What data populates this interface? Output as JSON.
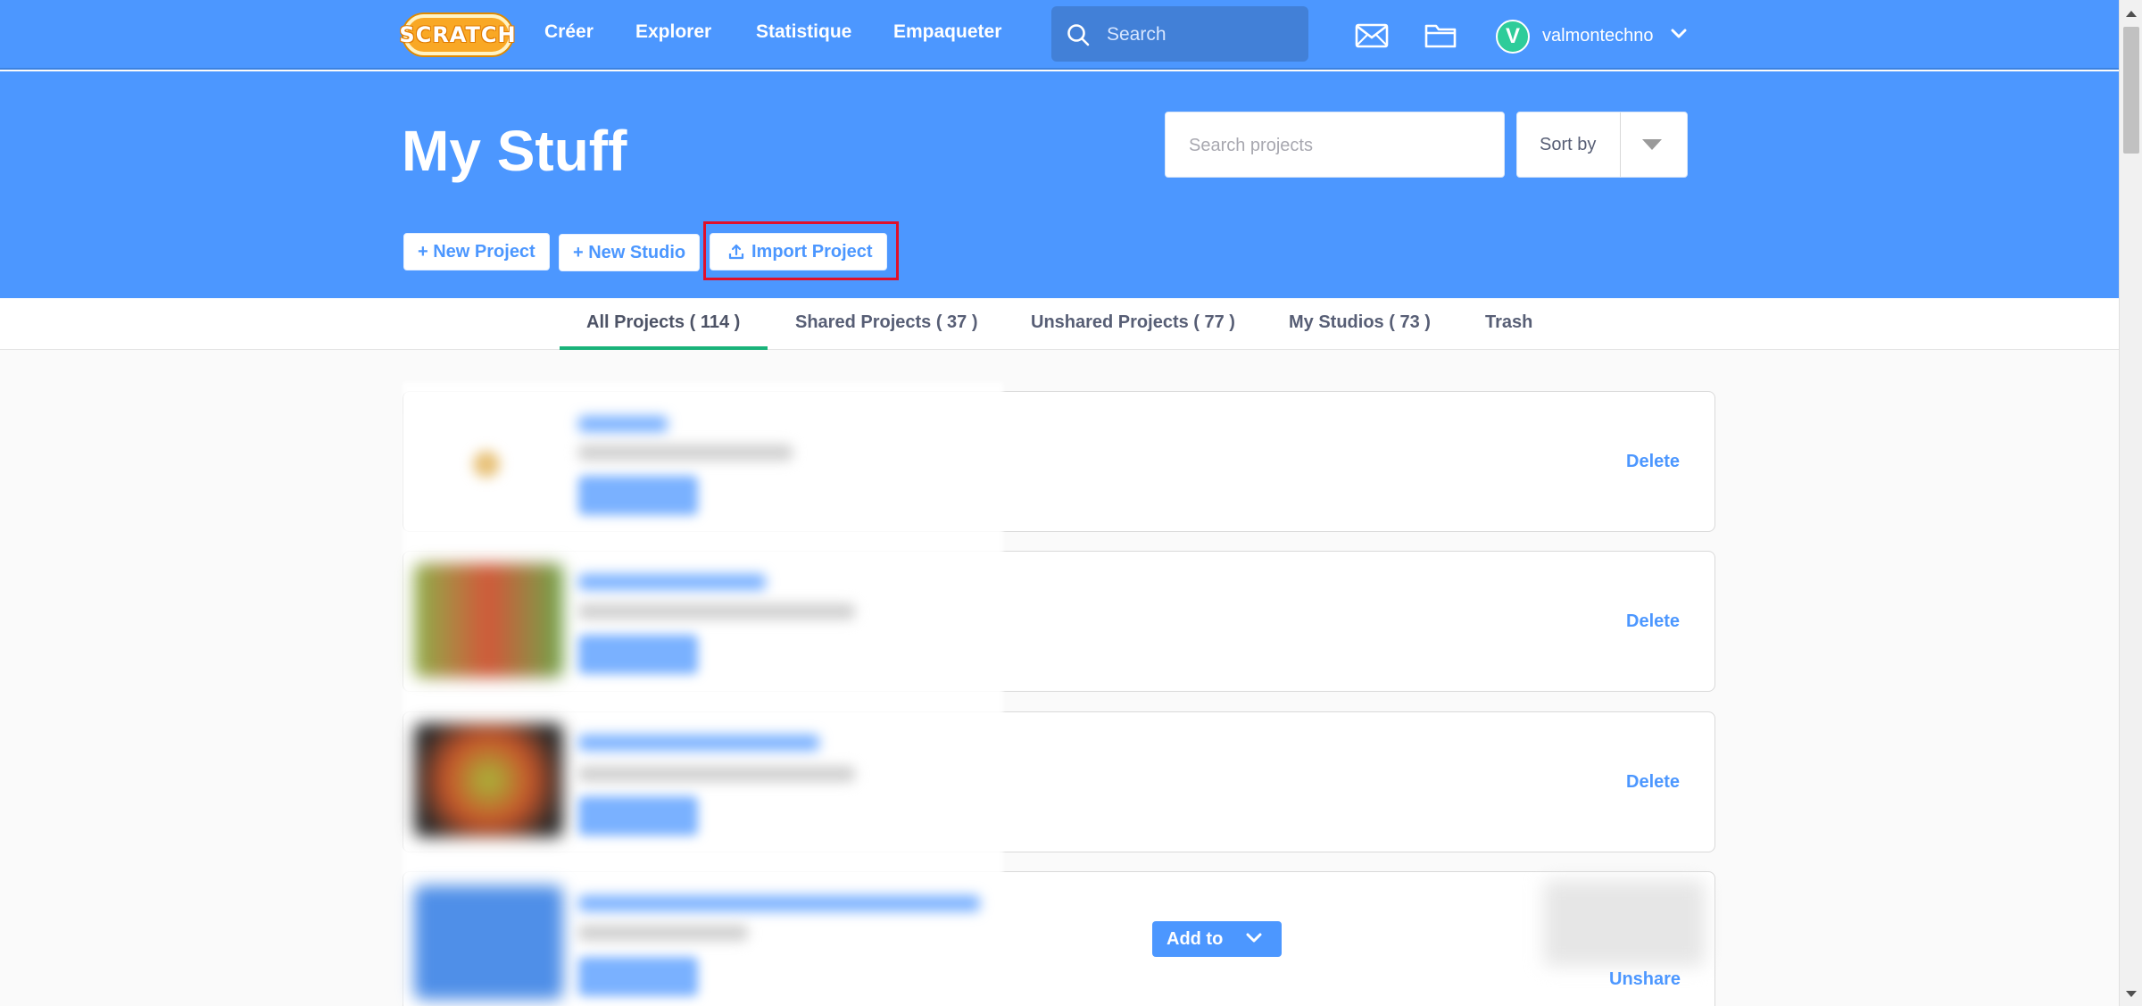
{
  "nav": {
    "logo_text": "SCRATCH",
    "links": [
      "Créer",
      "Explorer",
      "Statistique",
      "Empaqueter"
    ],
    "search_placeholder": "Search",
    "username": "valmontechno",
    "avatar_letter": "V",
    "icons": [
      "search-icon",
      "messages-icon",
      "my-stuff-folder-icon",
      "chevron-down-icon"
    ]
  },
  "header": {
    "title": "My Stuff",
    "search_placeholder": "Search projects",
    "sort_label": "Sort by",
    "buttons": {
      "new_project": "+ New Project",
      "new_studio": "+ New Studio",
      "import_project": "Import Project"
    },
    "highlighted_button": "import_project"
  },
  "tabs": [
    {
      "label": "All Projects ( 114 )",
      "active": true
    },
    {
      "label": "Shared Projects ( 37 )",
      "active": false
    },
    {
      "label": "Unshared Projects ( 77 )",
      "active": false
    },
    {
      "label": "My Studios ( 73 )",
      "active": false
    },
    {
      "label": "Trash",
      "active": false
    }
  ],
  "projects": [
    {
      "action": "Delete"
    },
    {
      "action": "Delete"
    },
    {
      "action": "Delete"
    },
    {
      "action": "Unshare",
      "add_to_label": "Add to"
    }
  ],
  "colors": {
    "brand_blue": "#4c97ff",
    "active_tab_underline": "#1ab37a",
    "highlight_red": "#e0102a"
  }
}
